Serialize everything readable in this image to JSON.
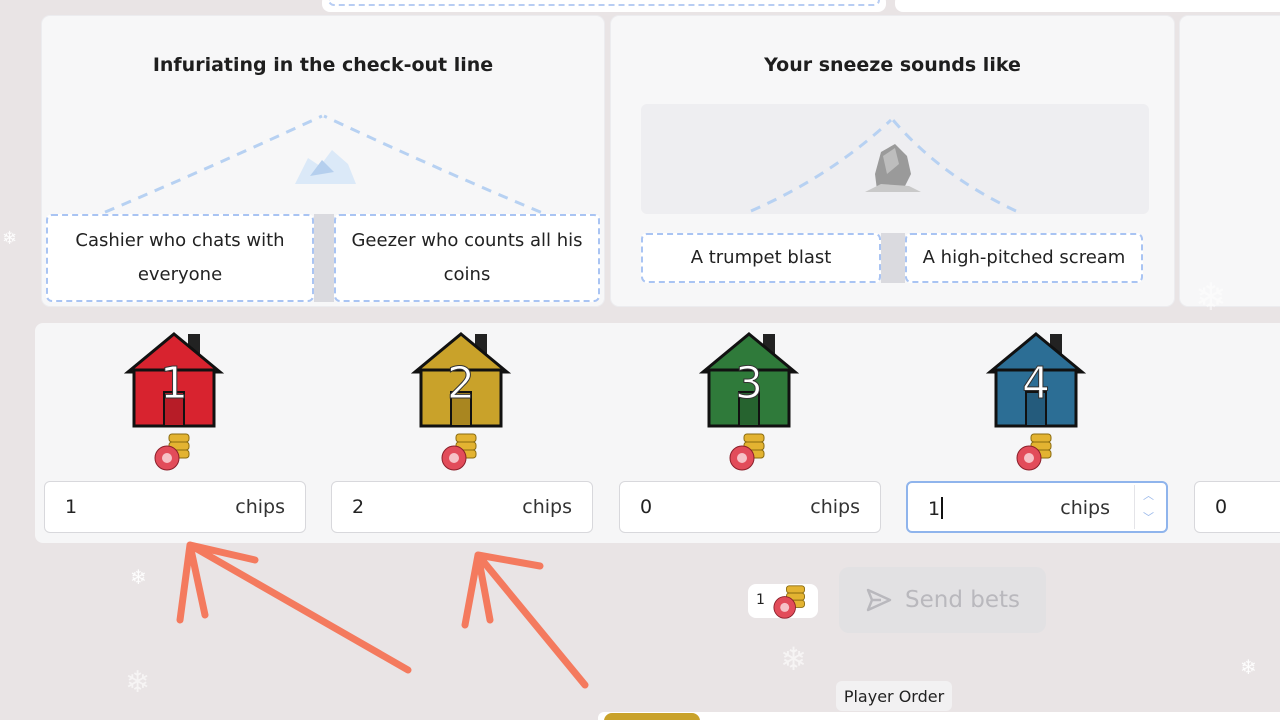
{
  "questions": [
    {
      "title": "Infuriating in the check-out line",
      "answer_left": "Cashier who chats with everyone",
      "answer_right": "Geezer who counts all his coins",
      "image_icon": "ice-cave-icon"
    },
    {
      "title": "Your sneeze sounds like",
      "answer_left": "A trumpet blast",
      "answer_right": "A high-pitched scream",
      "image_icon": "rock-icon"
    }
  ],
  "bets": [
    {
      "number": "1",
      "color": "#d8232f",
      "value": "1",
      "unit": "chips"
    },
    {
      "number": "2",
      "color": "#c9a22a",
      "value": "2",
      "unit": "chips"
    },
    {
      "number": "3",
      "color": "#2f7a3a",
      "value": "0",
      "unit": "chips"
    },
    {
      "number": "4",
      "color": "#2c6e95",
      "value": "1",
      "unit": "chips"
    },
    {
      "number": "",
      "color": "#555555",
      "value": "0",
      "unit": ""
    }
  ],
  "balance": "1",
  "send_label": "Send bets",
  "tooltip": "Player Order",
  "colors": {
    "accent": "#a9c4f3",
    "arrow": "#f47a5e",
    "send_disabled": "#e2e1e3"
  }
}
